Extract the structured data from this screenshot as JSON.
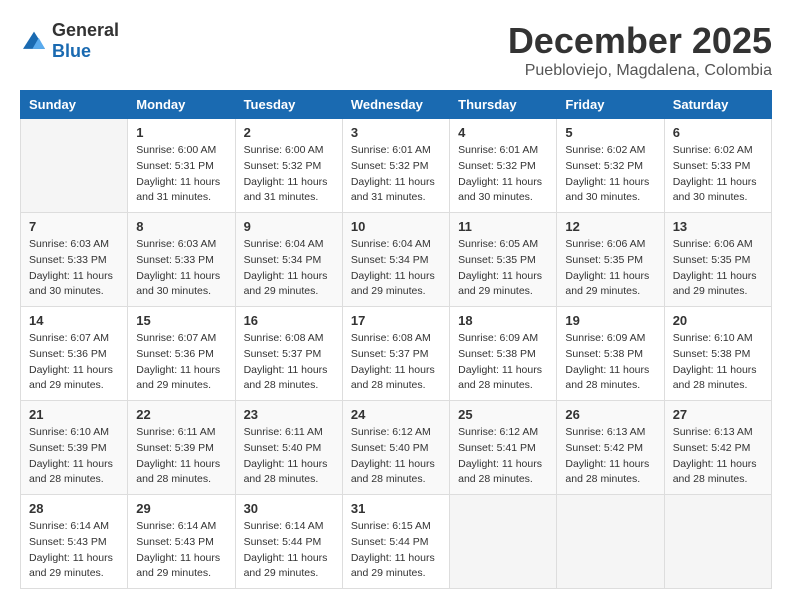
{
  "logo": {
    "general": "General",
    "blue": "Blue"
  },
  "header": {
    "month": "December 2025",
    "location": "Puebloviejo, Magdalena, Colombia"
  },
  "weekdays": [
    "Sunday",
    "Monday",
    "Tuesday",
    "Wednesday",
    "Thursday",
    "Friday",
    "Saturday"
  ],
  "weeks": [
    [
      {
        "day": "",
        "sunrise": "",
        "sunset": "",
        "daylight": ""
      },
      {
        "day": "1",
        "sunrise": "Sunrise: 6:00 AM",
        "sunset": "Sunset: 5:31 PM",
        "daylight": "Daylight: 11 hours and 31 minutes."
      },
      {
        "day": "2",
        "sunrise": "Sunrise: 6:00 AM",
        "sunset": "Sunset: 5:32 PM",
        "daylight": "Daylight: 11 hours and 31 minutes."
      },
      {
        "day": "3",
        "sunrise": "Sunrise: 6:01 AM",
        "sunset": "Sunset: 5:32 PM",
        "daylight": "Daylight: 11 hours and 31 minutes."
      },
      {
        "day": "4",
        "sunrise": "Sunrise: 6:01 AM",
        "sunset": "Sunset: 5:32 PM",
        "daylight": "Daylight: 11 hours and 30 minutes."
      },
      {
        "day": "5",
        "sunrise": "Sunrise: 6:02 AM",
        "sunset": "Sunset: 5:32 PM",
        "daylight": "Daylight: 11 hours and 30 minutes."
      },
      {
        "day": "6",
        "sunrise": "Sunrise: 6:02 AM",
        "sunset": "Sunset: 5:33 PM",
        "daylight": "Daylight: 11 hours and 30 minutes."
      }
    ],
    [
      {
        "day": "7",
        "sunrise": "Sunrise: 6:03 AM",
        "sunset": "Sunset: 5:33 PM",
        "daylight": "Daylight: 11 hours and 30 minutes."
      },
      {
        "day": "8",
        "sunrise": "Sunrise: 6:03 AM",
        "sunset": "Sunset: 5:33 PM",
        "daylight": "Daylight: 11 hours and 30 minutes."
      },
      {
        "day": "9",
        "sunrise": "Sunrise: 6:04 AM",
        "sunset": "Sunset: 5:34 PM",
        "daylight": "Daylight: 11 hours and 29 minutes."
      },
      {
        "day": "10",
        "sunrise": "Sunrise: 6:04 AM",
        "sunset": "Sunset: 5:34 PM",
        "daylight": "Daylight: 11 hours and 29 minutes."
      },
      {
        "day": "11",
        "sunrise": "Sunrise: 6:05 AM",
        "sunset": "Sunset: 5:35 PM",
        "daylight": "Daylight: 11 hours and 29 minutes."
      },
      {
        "day": "12",
        "sunrise": "Sunrise: 6:06 AM",
        "sunset": "Sunset: 5:35 PM",
        "daylight": "Daylight: 11 hours and 29 minutes."
      },
      {
        "day": "13",
        "sunrise": "Sunrise: 6:06 AM",
        "sunset": "Sunset: 5:35 PM",
        "daylight": "Daylight: 11 hours and 29 minutes."
      }
    ],
    [
      {
        "day": "14",
        "sunrise": "Sunrise: 6:07 AM",
        "sunset": "Sunset: 5:36 PM",
        "daylight": "Daylight: 11 hours and 29 minutes."
      },
      {
        "day": "15",
        "sunrise": "Sunrise: 6:07 AM",
        "sunset": "Sunset: 5:36 PM",
        "daylight": "Daylight: 11 hours and 29 minutes."
      },
      {
        "day": "16",
        "sunrise": "Sunrise: 6:08 AM",
        "sunset": "Sunset: 5:37 PM",
        "daylight": "Daylight: 11 hours and 28 minutes."
      },
      {
        "day": "17",
        "sunrise": "Sunrise: 6:08 AM",
        "sunset": "Sunset: 5:37 PM",
        "daylight": "Daylight: 11 hours and 28 minutes."
      },
      {
        "day": "18",
        "sunrise": "Sunrise: 6:09 AM",
        "sunset": "Sunset: 5:38 PM",
        "daylight": "Daylight: 11 hours and 28 minutes."
      },
      {
        "day": "19",
        "sunrise": "Sunrise: 6:09 AM",
        "sunset": "Sunset: 5:38 PM",
        "daylight": "Daylight: 11 hours and 28 minutes."
      },
      {
        "day": "20",
        "sunrise": "Sunrise: 6:10 AM",
        "sunset": "Sunset: 5:38 PM",
        "daylight": "Daylight: 11 hours and 28 minutes."
      }
    ],
    [
      {
        "day": "21",
        "sunrise": "Sunrise: 6:10 AM",
        "sunset": "Sunset: 5:39 PM",
        "daylight": "Daylight: 11 hours and 28 minutes."
      },
      {
        "day": "22",
        "sunrise": "Sunrise: 6:11 AM",
        "sunset": "Sunset: 5:39 PM",
        "daylight": "Daylight: 11 hours and 28 minutes."
      },
      {
        "day": "23",
        "sunrise": "Sunrise: 6:11 AM",
        "sunset": "Sunset: 5:40 PM",
        "daylight": "Daylight: 11 hours and 28 minutes."
      },
      {
        "day": "24",
        "sunrise": "Sunrise: 6:12 AM",
        "sunset": "Sunset: 5:40 PM",
        "daylight": "Daylight: 11 hours and 28 minutes."
      },
      {
        "day": "25",
        "sunrise": "Sunrise: 6:12 AM",
        "sunset": "Sunset: 5:41 PM",
        "daylight": "Daylight: 11 hours and 28 minutes."
      },
      {
        "day": "26",
        "sunrise": "Sunrise: 6:13 AM",
        "sunset": "Sunset: 5:42 PM",
        "daylight": "Daylight: 11 hours and 28 minutes."
      },
      {
        "day": "27",
        "sunrise": "Sunrise: 6:13 AM",
        "sunset": "Sunset: 5:42 PM",
        "daylight": "Daylight: 11 hours and 28 minutes."
      }
    ],
    [
      {
        "day": "28",
        "sunrise": "Sunrise: 6:14 AM",
        "sunset": "Sunset: 5:43 PM",
        "daylight": "Daylight: 11 hours and 29 minutes."
      },
      {
        "day": "29",
        "sunrise": "Sunrise: 6:14 AM",
        "sunset": "Sunset: 5:43 PM",
        "daylight": "Daylight: 11 hours and 29 minutes."
      },
      {
        "day": "30",
        "sunrise": "Sunrise: 6:14 AM",
        "sunset": "Sunset: 5:44 PM",
        "daylight": "Daylight: 11 hours and 29 minutes."
      },
      {
        "day": "31",
        "sunrise": "Sunrise: 6:15 AM",
        "sunset": "Sunset: 5:44 PM",
        "daylight": "Daylight: 11 hours and 29 minutes."
      },
      {
        "day": "",
        "sunrise": "",
        "sunset": "",
        "daylight": ""
      },
      {
        "day": "",
        "sunrise": "",
        "sunset": "",
        "daylight": ""
      },
      {
        "day": "",
        "sunrise": "",
        "sunset": "",
        "daylight": ""
      }
    ]
  ]
}
